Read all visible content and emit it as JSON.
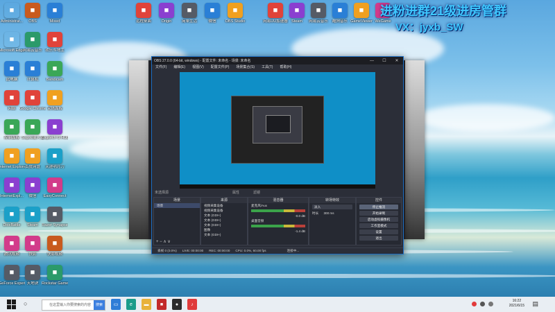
{
  "desktop": {
    "icons_left_col1": [
      "Administrat...",
      "Microsoft Edge",
      "此电脑",
      "网络",
      "控制面板",
      "Internet Explorer",
      "InternetExpl...",
      "DiceBattle",
      "腾讯视频",
      "GeForce Experience"
    ],
    "icons_left_col2": [
      "OBS",
      "网易云音乐",
      "计算机",
      "Google Chrome",
      "Sogou输入法",
      "百度网盘",
      "微信",
      "Steam",
      "快影",
      "天地诀"
    ],
    "icons_left_col3": [
      "Mixed",
      "欢乐斗地主",
      "Bandicam",
      "宝塔面板",
      "Logitech G HUB",
      "天涯明月刀",
      "EasyConnect",
      "Razer Synapse",
      "快影视频",
      "Rockstar Games"
    ],
    "icons_top": [
      "远程桌面",
      "Origin",
      "简单生活",
      "微信",
      "OBS Studio"
    ],
    "icons_top_right": [
      "网易UU加速器",
      "Steam",
      "网易云音乐",
      "酷狗音乐",
      "GameViewer",
      "WeGame"
    ],
    "overlay_line1": "进粉进群21级进房管群",
    "overlay_line2": "VX：jyxb_SW"
  },
  "obs": {
    "title": "OBS 27.0.0 (64-bit, windows) - 配置文件: 未命名 - 场景: 未命名",
    "menu": [
      "文件(F)",
      "编辑(E)",
      "视图(V)",
      "配置文件(P)",
      "场景集合(S)",
      "工具(T)",
      "帮助(H)"
    ],
    "no_source": "未选择源",
    "tabs": [
      "属性",
      "滤镜"
    ],
    "scenes": {
      "header": "场景",
      "items": [
        "场景"
      ]
    },
    "sources": {
      "header": "来源",
      "items": [
        "视频采集设备",
        "视频采集设备",
        "文本 (GDI+)",
        "文本 (GDI+)",
        "文本 (GDI+)",
        "图像",
        "文本 (GDI+)"
      ]
    },
    "mixer": {
      "header": "混音器",
      "tracks": [
        {
          "name": "麦克风/Aux",
          "db": "-0.0 dB"
        },
        {
          "name": "桌面音频",
          "db": "-1.4 dB"
        }
      ]
    },
    "transitions": {
      "header": "转场特效",
      "type": "淡入",
      "duration_label": "时长",
      "duration": "300 ms"
    },
    "controls": {
      "header": "控件",
      "buttons": [
        "停止推流",
        "开始录制",
        "启动虚拟摄像机",
        "工作室模式",
        "设置",
        "退出"
      ]
    },
    "status": {
      "drop": "丢帧 0 (0.0%)",
      "live": "LIVE: 00:00:00",
      "rec": "REC: 00:00:00",
      "cpu": "CPU: 0.0%, 60.00 fps",
      "right": "连接中..."
    }
  },
  "taskbar": {
    "search_placeholder": "在这里输入你要搜索的内容",
    "search_button": "搜索",
    "time": "16:22",
    "date": "2021/6/15"
  }
}
